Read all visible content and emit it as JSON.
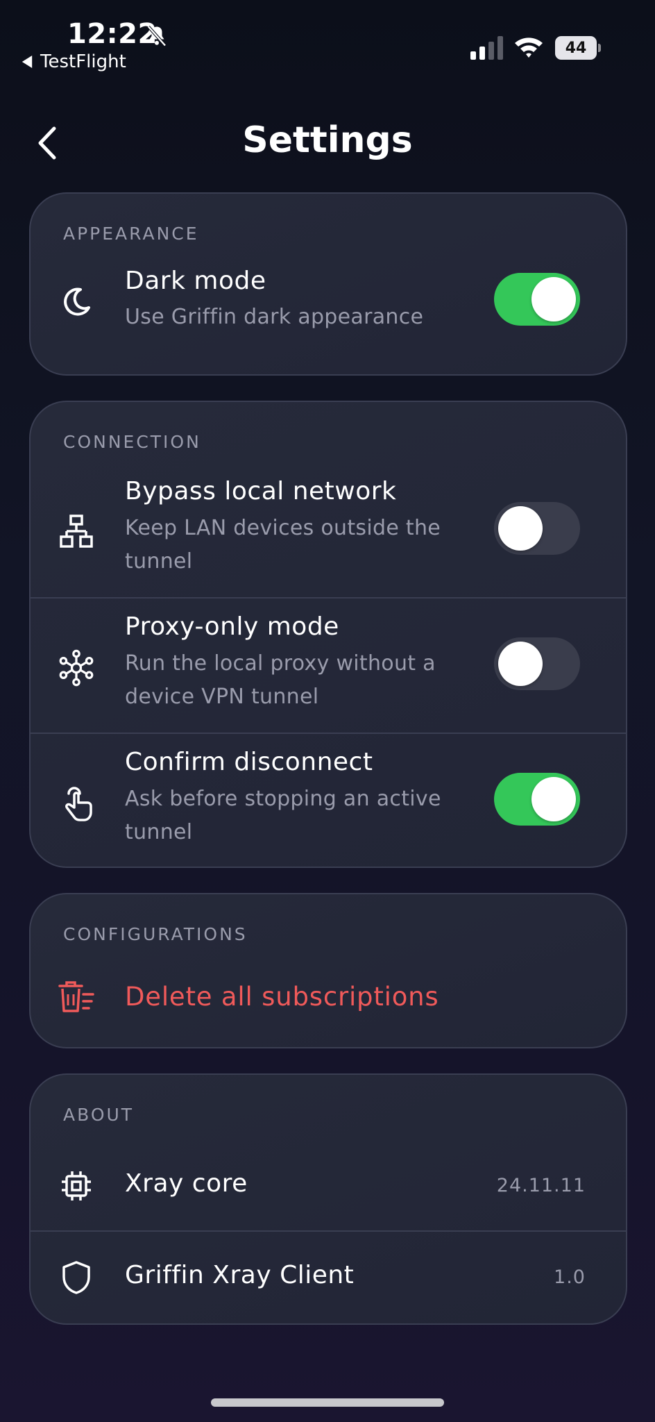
{
  "status_bar": {
    "time": "12:22",
    "back_app": "TestFlight",
    "battery": "44"
  },
  "nav": {
    "title": "Settings"
  },
  "appearance": {
    "section_label": "APPEARANCE",
    "dark_mode": {
      "title": "Dark mode",
      "subtitle": "Use Griffin dark appearance",
      "enabled": true,
      "icon": "moon-icon"
    }
  },
  "connection": {
    "section_label": "CONNECTION",
    "bypass": {
      "title": "Bypass local network",
      "subtitle": "Keep LAN devices outside the tunnel",
      "enabled": false,
      "icon": "network-icon"
    },
    "proxy_only": {
      "title": "Proxy-only mode",
      "subtitle": "Run the local proxy without a device VPN tunnel",
      "enabled": false,
      "icon": "hub-icon"
    },
    "confirm_disconnect": {
      "title": "Confirm disconnect",
      "subtitle": "Ask before stopping an active tunnel",
      "enabled": true,
      "icon": "tap-icon"
    }
  },
  "configurations": {
    "section_label": "CONFIGURATIONS",
    "delete_all": {
      "label": "Delete all subscriptions",
      "icon": "trash-list-icon"
    }
  },
  "about": {
    "section_label": "ABOUT",
    "xray_core": {
      "title": "Xray core",
      "value": "24.11.11",
      "icon": "chip-icon"
    },
    "client": {
      "title": "Griffin Xray Client",
      "value": "1.0",
      "icon": "shield-icon"
    }
  },
  "colors": {
    "toggle_on": "#34c759",
    "toggle_off": "#3a3d4c",
    "danger": "#f05a5a",
    "card_bg": "#262a3a",
    "muted_text": "#9a9cac"
  }
}
